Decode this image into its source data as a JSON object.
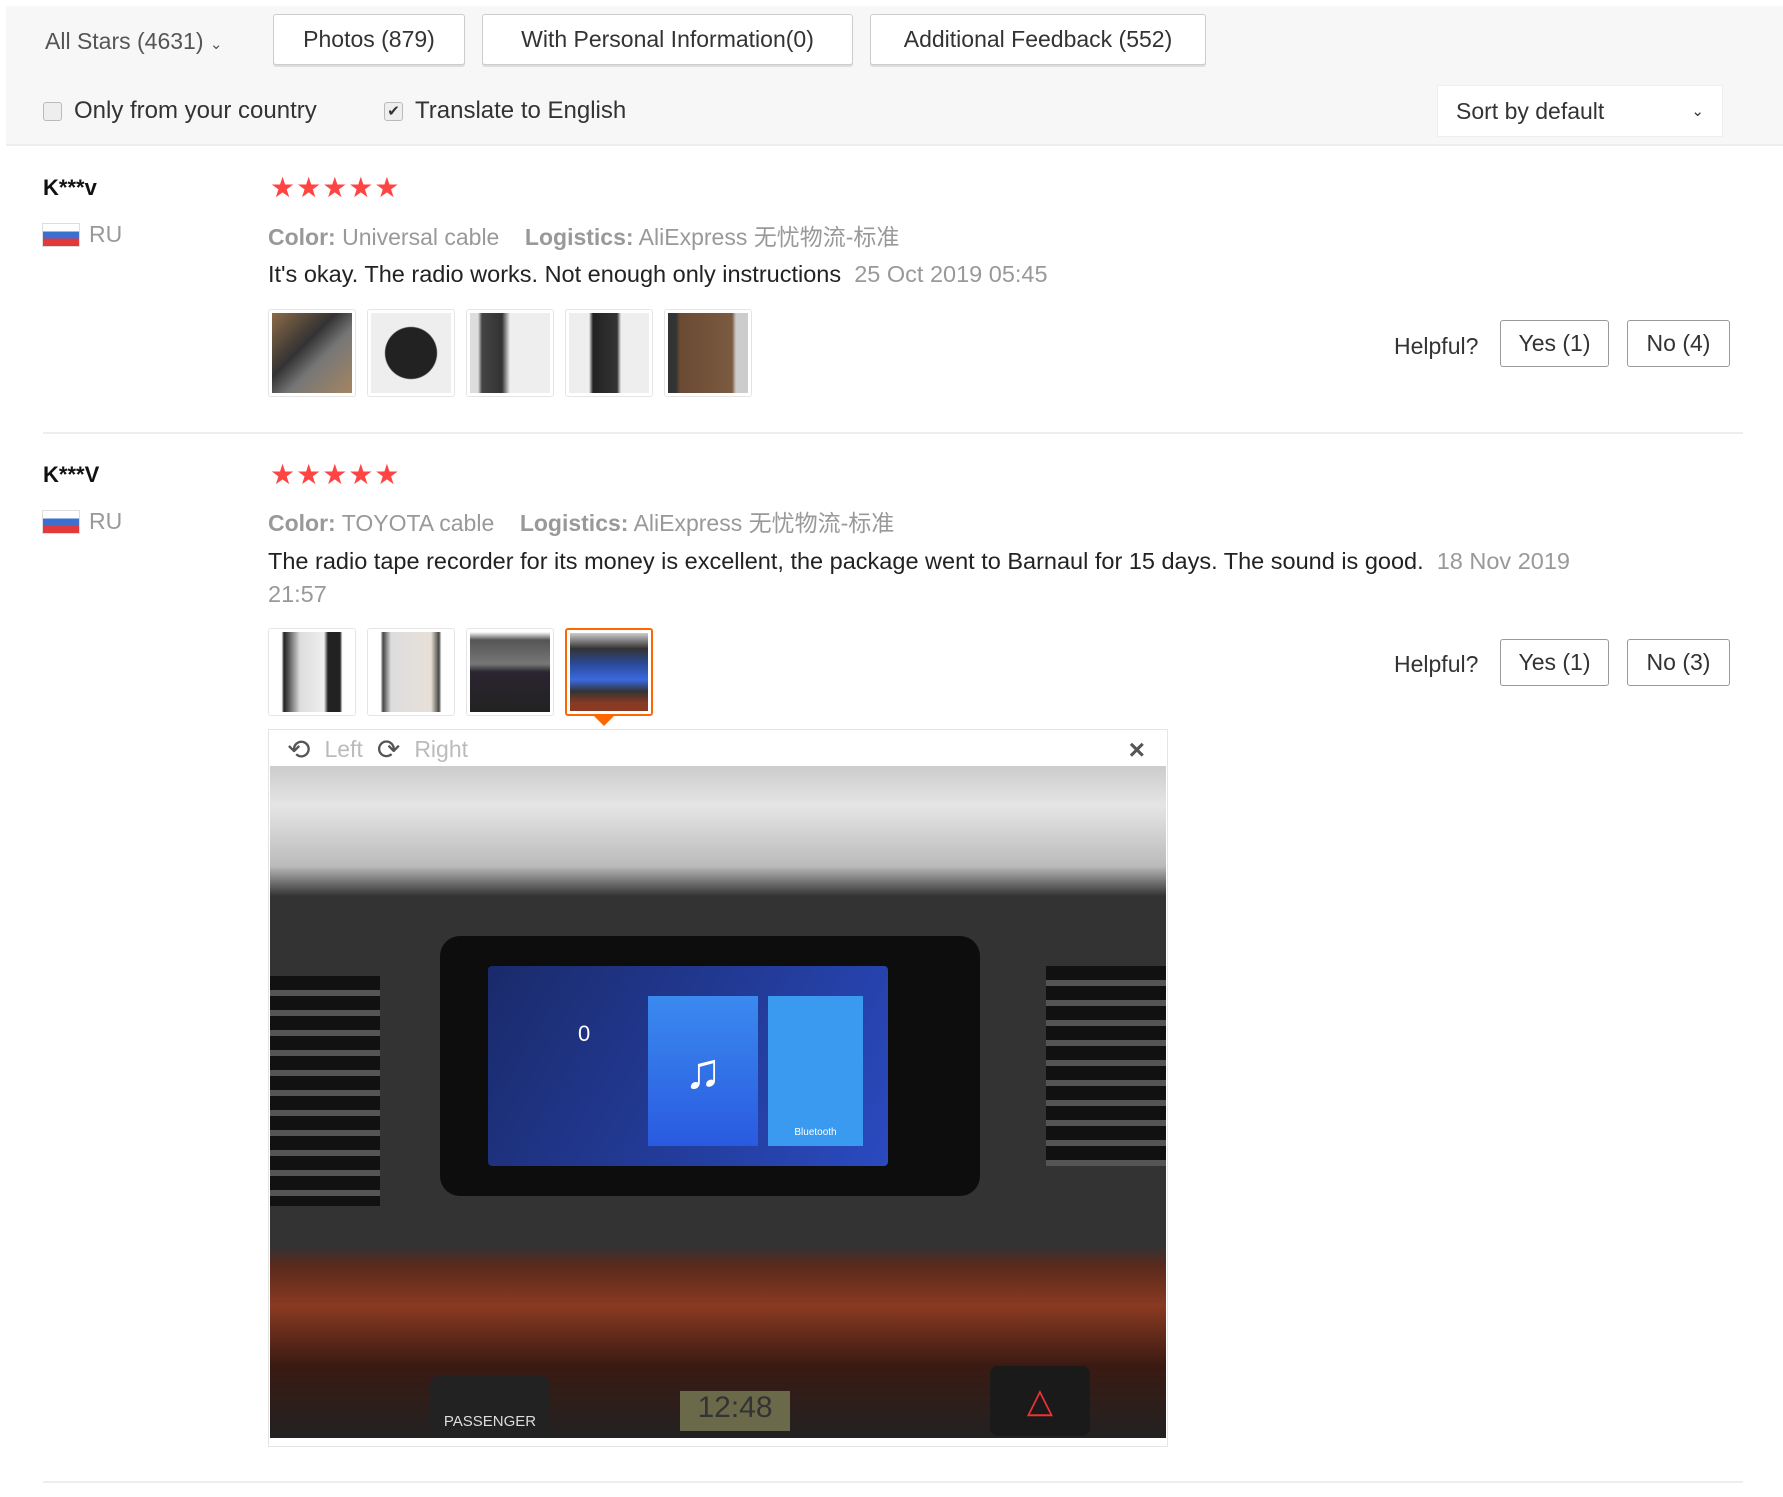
{
  "filters": {
    "all_stars": "All Stars (4631)",
    "photos": "Photos (879)",
    "personal": "With Personal Information(0)",
    "additional": "Additional Feedback (552)",
    "only_country": "Only from your country",
    "only_country_checked": false,
    "translate": "Translate to English",
    "translate_checked": true,
    "sort": "Sort by default"
  },
  "colors": {
    "stars": "#ff4444",
    "selected_thumb": "#ff6600"
  },
  "reviews": [
    {
      "name": "K***v",
      "country": "RU",
      "rating": 5,
      "stars": "★★★★★",
      "color_label": "Color:",
      "color": "Universal cable",
      "logistics_label": "Logistics:",
      "logistics": "AliExpress 无忧物流-标准",
      "text": "It's okay. The radio works. Not enough only instructions",
      "date": "25 Oct 2019 05:45",
      "helpful": "Helpful?",
      "yes": "Yes (1)",
      "no": "No (4)"
    },
    {
      "name": "K***V",
      "country": "RU",
      "rating": 5,
      "stars": "★★★★★",
      "color_label": "Color:",
      "color": "TOYOTA cable",
      "logistics_label": "Logistics:",
      "logistics": "AliExpress 无忧物流-标准",
      "text": "The radio tape recorder for its money is excellent, the package went to Barnaul for 15 days. The sound is good.",
      "date": "18 Nov 2019 21:57",
      "helpful": "Helpful?",
      "yes": "Yes (1)",
      "no": "No (3)"
    }
  ],
  "viewer": {
    "left": "Left",
    "right": "Right",
    "close": "×",
    "photo_text": {
      "passenger": "PASSENGER",
      "clock": "12:48",
      "speed": "0",
      "bluetooth": "Bluetooth"
    }
  }
}
